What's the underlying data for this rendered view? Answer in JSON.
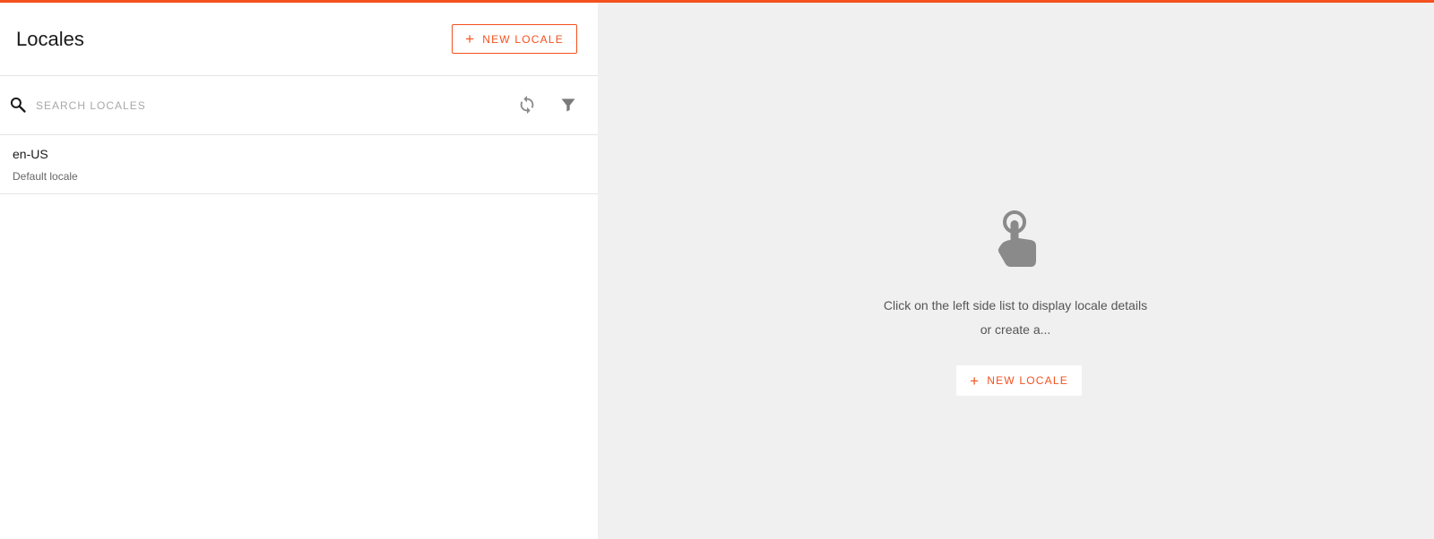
{
  "colors": {
    "accent": "#f4511e",
    "panel_background": "#f0f0f0",
    "icon_gray": "#8a8a8a"
  },
  "header": {
    "title": "Locales",
    "new_button": {
      "icon": "plus-icon",
      "label": "NEW LOCALE"
    }
  },
  "search": {
    "icon": "search-icon",
    "placeholder": "SEARCH LOCALES",
    "value": "",
    "refresh_icon": "refresh-icon",
    "filter_icon": "filter-icon"
  },
  "locales": [
    {
      "name": "en-US",
      "description": "Default locale"
    }
  ],
  "empty_state": {
    "icon": "tap-hand-icon",
    "message": "Click on the left side list to display locale details or create a...",
    "button": {
      "icon": "plus-icon",
      "label": "NEW LOCALE"
    }
  }
}
